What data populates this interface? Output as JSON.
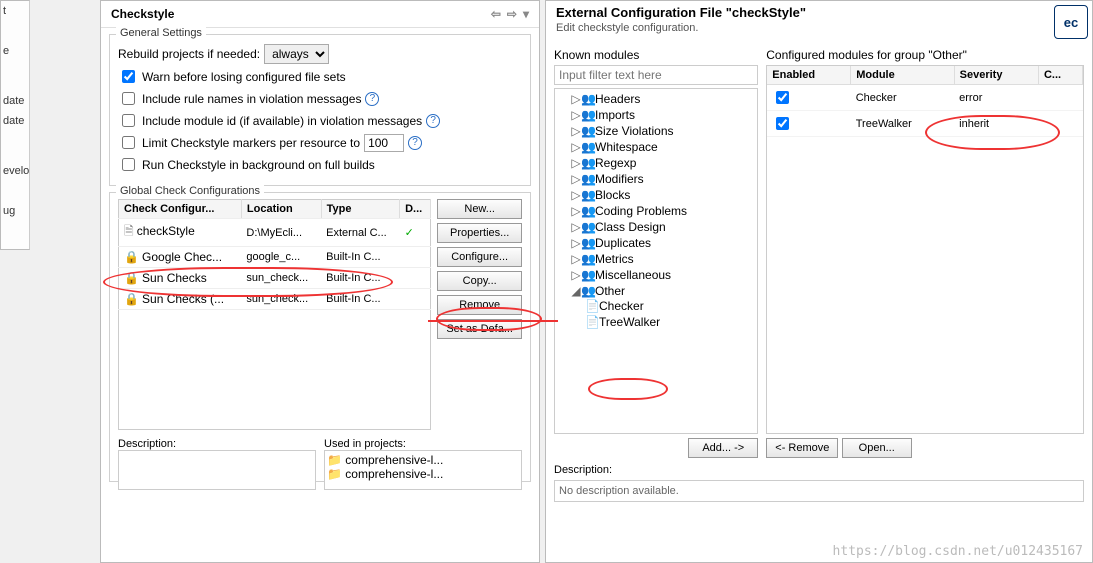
{
  "left": {
    "items": [
      "t",
      "e",
      "date",
      "date",
      "evelopment",
      "ug"
    ]
  },
  "prefs": {
    "title": "Checkstyle",
    "general_label": "General Settings",
    "rebuild_label": "Rebuild projects if needed:",
    "rebuild_value": "always",
    "warn": "Warn before losing configured file sets",
    "rulenames": "Include rule names in violation messages",
    "moduleid": "Include module id (if available) in violation messages",
    "limit": "Limit Checkstyle markers per resource to",
    "limit_val": "100",
    "runbg": "Run Checkstyle in background on full builds",
    "global_label": "Global Check Configurations",
    "cols": {
      "c1": "Check Configur...",
      "c2": "Location",
      "c3": "Type",
      "c4": "D..."
    },
    "rows": [
      {
        "name": "checkStyle",
        "loc": "D:\\MyEcli...",
        "type": "External C...",
        "def": "✓",
        "icon": "doc"
      },
      {
        "name": "Google Chec...",
        "loc": "google_c...",
        "type": "Built-In C...",
        "def": "",
        "icon": "lock"
      },
      {
        "name": "Sun Checks",
        "loc": "sun_check...",
        "type": "Built-In C...",
        "def": "",
        "icon": "lock"
      },
      {
        "name": "Sun Checks (...",
        "loc": "sun_check...",
        "type": "Built-In C...",
        "def": "",
        "icon": "lock"
      }
    ],
    "btns": {
      "new": "New...",
      "prop": "Properties...",
      "conf": "Configure...",
      "copy": "Copy...",
      "rem": "Remove",
      "def": "Set as Defa..."
    },
    "desc_label": "Description:",
    "used_label": "Used in projects:",
    "projects": [
      "comprehensive-l...",
      "comprehensive-l..."
    ]
  },
  "dlg": {
    "heading": "External Configuration File \"checkStyle\"",
    "sub": "Edit checkstyle configuration.",
    "known_label": "Known modules",
    "filter_ph": "Input filter text here",
    "tree": [
      "Headers",
      "Imports",
      "Size Violations",
      "Whitespace",
      "Regexp",
      "Modifiers",
      "Blocks",
      "Coding Problems",
      "Class Design",
      "Duplicates",
      "Metrics",
      "Miscellaneous"
    ],
    "other": "Other",
    "other_children": [
      "Checker",
      "TreeWalker"
    ],
    "add_btn": "Add... ->",
    "conf_label": "Configured modules for group \"Other\"",
    "mcols": {
      "en": "Enabled",
      "mod": "Module",
      "sev": "Severity",
      "c": "C..."
    },
    "mrows": [
      {
        "en": true,
        "mod": "Checker",
        "sev": "error"
      },
      {
        "en": true,
        "mod": "TreeWalker",
        "sev": "inherit"
      }
    ],
    "remove_btn": "<- Remove",
    "open_btn": "Open...",
    "desc_label": "Description:",
    "desc_text": "No description available."
  },
  "watermark": "https://blog.csdn.net/u012435167",
  "logo": "ec"
}
